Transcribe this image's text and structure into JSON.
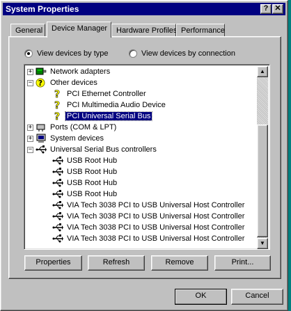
{
  "window": {
    "title": "System Properties",
    "help_glyph": "?",
    "close_glyph": "✕"
  },
  "tabs": [
    {
      "label": "General",
      "active": false
    },
    {
      "label": "Device Manager",
      "active": true
    },
    {
      "label": "Hardware Profiles",
      "active": false
    },
    {
      "label": "Performance",
      "active": false
    }
  ],
  "view": {
    "by_type": "View devices by type",
    "by_connection": "View devices by connection",
    "selected": "by_type"
  },
  "tree": [
    {
      "label": "Network adapters",
      "level": 0,
      "expander": "+",
      "icon": "network-adapter-icon"
    },
    {
      "label": "Other devices",
      "level": 0,
      "expander": "−",
      "icon": "question-mark-icon"
    },
    {
      "label": "PCI Ethernet Controller",
      "level": 1,
      "icon": "unknown-device-icon"
    },
    {
      "label": "PCI Multimedia Audio Device",
      "level": 1,
      "icon": "unknown-device-icon"
    },
    {
      "label": "PCI Universal Serial Bus",
      "level": 1,
      "icon": "unknown-device-icon",
      "selected": true
    },
    {
      "label": "Ports (COM & LPT)",
      "level": 0,
      "expander": "+",
      "icon": "port-icon"
    },
    {
      "label": "System devices",
      "level": 0,
      "expander": "+",
      "icon": "computer-icon"
    },
    {
      "label": "Universal Serial Bus controllers",
      "level": 0,
      "expander": "−",
      "icon": "usb-icon"
    },
    {
      "label": "USB Root Hub",
      "level": 1,
      "icon": "usb-icon"
    },
    {
      "label": "USB Root Hub",
      "level": 1,
      "icon": "usb-icon"
    },
    {
      "label": "USB Root Hub",
      "level": 1,
      "icon": "usb-icon"
    },
    {
      "label": "USB Root Hub",
      "level": 1,
      "icon": "usb-icon"
    },
    {
      "label": "VIA Tech 3038 PCI to USB Universal Host Controller",
      "level": 1,
      "icon": "usb-icon"
    },
    {
      "label": "VIA Tech 3038 PCI to USB Universal Host Controller",
      "level": 1,
      "icon": "usb-icon"
    },
    {
      "label": "VIA Tech 3038 PCI to USB Universal Host Controller",
      "level": 1,
      "icon": "usb-icon"
    },
    {
      "label": "VIA Tech 3038 PCI to USB Universal Host Controller",
      "level": 1,
      "icon": "usb-icon"
    }
  ],
  "buttons": {
    "properties": "Properties",
    "refresh": "Refresh",
    "remove": "Remove",
    "print": "Print...",
    "ok": "OK",
    "cancel": "Cancel"
  },
  "scrollbar": {
    "up_glyph": "▲",
    "down_glyph": "▼"
  }
}
